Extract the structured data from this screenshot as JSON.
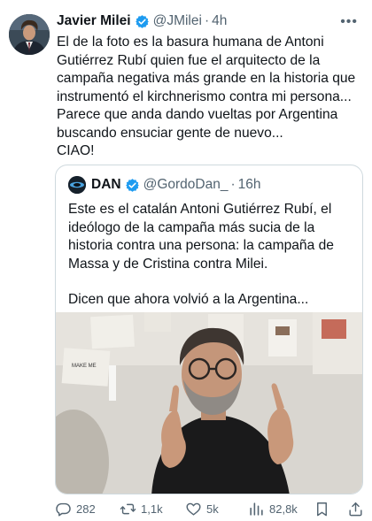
{
  "author": {
    "name": "Javier Milei",
    "handle": "@JMilei",
    "separator": "·",
    "time": "4h",
    "more_icon": "more-dots-icon",
    "verified_color": "#1d9bf0"
  },
  "tweet_text": [
    "El de la foto es la basura humana de Antoni",
    "Gutiérrez Rubí quien fue el arquitecto de la",
    "campaña negativa más grande en la historia que",
    "instrumentó el kirchnerismo contra mi persona...",
    "Parece que anda dando vueltas por Argentina",
    "buscando ensuciar gente de nuevo...",
    "CIAO!"
  ],
  "quoted": {
    "name": "DAN",
    "handle": "@GordoDan_",
    "separator": "·",
    "time": "16h",
    "text_lines": [
      "Este es el catalán Antoni Gutiérrez Rubí, el",
      "ideólogo de la campaña más sucia de la",
      "historia contra una persona: la campaña de",
      "Massa y de Cristina contra Milei."
    ],
    "text_lines_2": [
      "Dicen que ahora volvió a la Argentina..."
    ]
  },
  "actions": {
    "replies": "282",
    "reposts": "1,1k",
    "likes": "5k",
    "views": "82,8k",
    "icons": [
      "reply-icon",
      "repost-icon",
      "like-icon",
      "views-icon",
      "bookmark-icon",
      "share-icon"
    ]
  }
}
